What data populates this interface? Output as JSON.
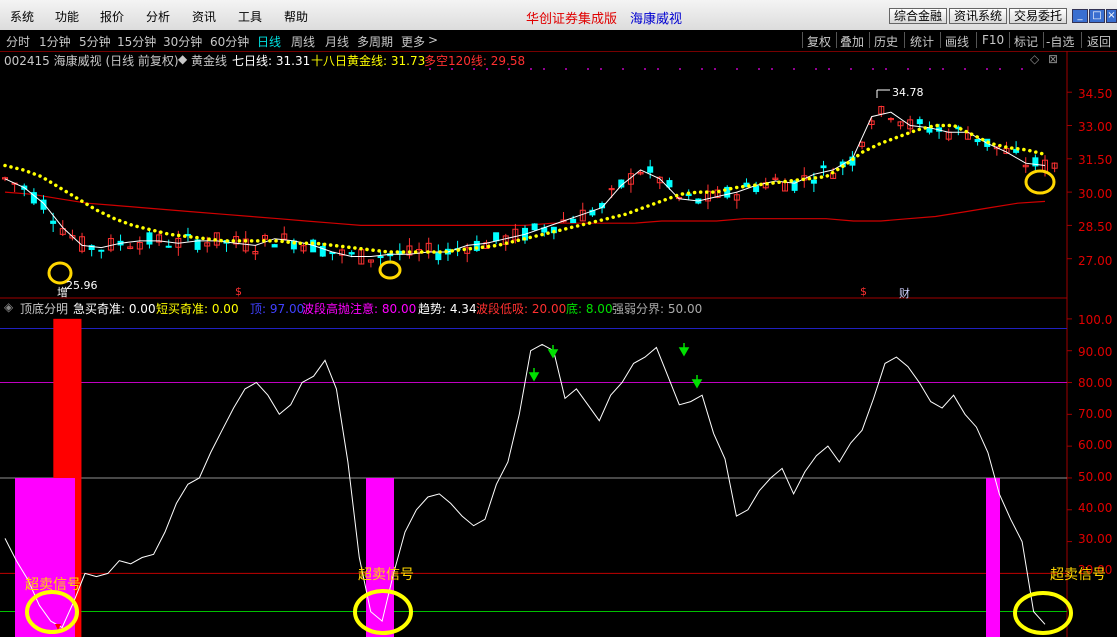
{
  "menu": {
    "items": [
      "系统",
      "功能",
      "报价",
      "分析",
      "资讯",
      "工具",
      "帮助"
    ],
    "app_title": "华创证券集成版",
    "stock_title": "海康威视",
    "buttons": [
      "综合金融",
      "资讯系统",
      "交易委托"
    ]
  },
  "periods": {
    "items": [
      "分时",
      "1分钟",
      "5分钟",
      "15分钟",
      "30分钟",
      "60分钟",
      "日线",
      "周线",
      "月线",
      "多周期",
      "更多"
    ],
    "active": "日线",
    "tools": [
      "复权",
      "叠加",
      "历史",
      "统计",
      "画线",
      "F10",
      "标记",
      "-自选",
      "返回"
    ]
  },
  "main_info": {
    "code_name": "002415 海康威视 (日线 前复权)",
    "indicator": "黄金线",
    "ma7_label": "七日线: 31.31",
    "ma18_label": "十八日黄金线: 31.73",
    "ma120_label": "多空120线: 29.58"
  },
  "main_axis": {
    "labels": [
      "34.50",
      "33.00",
      "31.50",
      "30.00",
      "28.50",
      "27.00"
    ]
  },
  "annotations": {
    "high_price": "34.78",
    "low_price": "25.96",
    "low_prefix": "增",
    "marker_s": "$",
    "marker_cai": "财"
  },
  "indicator_info": {
    "name": "顶底分明",
    "fields": [
      {
        "text": "急买奇准: 0.00",
        "color": "#ffffff"
      },
      {
        "text": "短买奇准: 0.00",
        "color": "#ffff00"
      },
      {
        "text": "顶: 97.00",
        "color": "#4040ff"
      },
      {
        "text": "波段高抛注意: 80.00",
        "color": "#ff00ff"
      },
      {
        "text": "趋势: 4.34",
        "color": "#ffffff"
      },
      {
        "text": "波段低吸: 20.00",
        "color": "#ff3030"
      },
      {
        "text": "底: 8.00",
        "color": "#00e000"
      },
      {
        "text": "强弱分界: 50.00",
        "color": "#aaaaaa"
      }
    ]
  },
  "indicator_axis": {
    "labels": [
      "100.0",
      "90.00",
      "80.00",
      "70.00",
      "60.00",
      "50.00",
      "40.00",
      "30.00",
      "20.00"
    ]
  },
  "signals": {
    "oversold": "超卖信号"
  },
  "chart_data": [
    {
      "type": "candlestick",
      "title": "002415 海康威视 (日线 前复权)",
      "ylim": [
        25.5,
        35.5
      ],
      "series": [
        {
          "name": "黄金线",
          "color": "#ffff00",
          "values": [
            31.2,
            31.0,
            30.7,
            30.2,
            29.7,
            29.2,
            28.8,
            28.5,
            28.3,
            28.1,
            28.0,
            27.9,
            27.8,
            27.8,
            27.8,
            27.8,
            27.7,
            27.7,
            27.6,
            27.5,
            27.4,
            27.3,
            27.3,
            27.3,
            27.3,
            27.4,
            27.5,
            27.6,
            27.8,
            28.0,
            28.2,
            28.4,
            28.6,
            28.8,
            29.0,
            29.3,
            29.6,
            29.9,
            30.0,
            30.0,
            30.2,
            30.3,
            30.4,
            30.5,
            30.6,
            30.7,
            31.2,
            31.8,
            32.2,
            32.5,
            32.8,
            33.0,
            33.0,
            32.6,
            32.2,
            32.0,
            31.9,
            31.7
          ]
        },
        {
          "name": "七日线",
          "color": "#ffffff",
          "values": [
            30.6,
            30.2,
            29.5,
            28.4,
            27.6,
            27.5,
            27.7,
            27.8,
            27.8,
            27.7,
            27.8,
            27.8,
            27.7,
            27.6,
            27.9,
            27.8,
            27.6,
            27.3,
            27.1,
            27.1,
            27.2,
            27.2,
            27.3,
            27.3,
            27.6,
            27.7,
            27.9,
            28.1,
            28.4,
            28.7,
            29.0,
            29.3,
            30.3,
            31.0,
            30.6,
            29.7,
            29.6,
            29.8,
            30.0,
            30.3,
            30.5,
            30.4,
            30.8,
            31.0,
            31.5,
            33.4,
            33.6,
            33.0,
            32.9,
            32.7,
            32.7,
            32.2,
            31.8,
            31.3,
            31.2
          ]
        },
        {
          "name": "多空120线",
          "color": "#d00000",
          "values": [
            30.0,
            29.9,
            29.7,
            29.5,
            29.4,
            29.3,
            29.2,
            29.1,
            29.0,
            28.9,
            28.8,
            28.7,
            28.6,
            28.5,
            28.5,
            28.5,
            28.5,
            28.5,
            28.5,
            28.5,
            28.6,
            28.6,
            28.6,
            28.6,
            28.7,
            28.7,
            28.7,
            28.8,
            28.8,
            28.8,
            28.8,
            28.7,
            28.7,
            28.8,
            28.9,
            29.1,
            29.3,
            29.5,
            29.58
          ]
        }
      ],
      "annotations": [
        {
          "text": "34.78",
          "value": 34.78
        },
        {
          "text": "25.96",
          "value": 25.96
        }
      ]
    },
    {
      "type": "line",
      "title": "顶底分明",
      "ylim": [
        0,
        105
      ],
      "reference_lines": [
        {
          "name": "顶",
          "value": 97,
          "color": "#2020c0"
        },
        {
          "name": "波段高抛注意",
          "value": 80,
          "color": "#c000c0"
        },
        {
          "name": "强弱分界",
          "value": 50,
          "color": "#909090"
        },
        {
          "name": "波段低吸",
          "value": 20,
          "color": "#c00000"
        },
        {
          "name": "底",
          "value": 8,
          "color": "#00c000"
        }
      ],
      "series": [
        {
          "name": "趋势",
          "color": "#ffffff",
          "values": [
            31,
            24,
            18,
            10,
            5,
            3,
            11,
            20,
            19,
            20,
            24,
            23,
            25,
            26,
            33,
            42,
            48,
            50,
            58,
            65,
            72,
            78,
            80,
            76,
            70,
            73,
            80,
            82,
            87,
            78,
            55,
            25,
            8,
            5,
            20,
            33,
            40,
            44,
            45,
            42,
            38,
            35,
            37,
            48,
            55,
            70,
            90,
            92,
            90,
            75,
            78,
            73,
            68,
            76,
            80,
            86,
            88,
            91,
            82,
            73,
            74,
            76,
            64,
            56,
            38,
            40,
            46,
            50,
            53,
            45,
            52,
            57,
            60,
            55,
            61,
            65,
            75,
            86,
            88,
            85,
            80,
            74,
            72,
            76,
            70,
            66,
            58,
            45,
            37,
            30,
            8,
            4
          ]
        },
        {
          "name": "急买奇准",
          "color": "#ff0000",
          "bars": [
            {
              "position": 0.06,
              "value": 100
            }
          ]
        },
        {
          "name": "短买奇准",
          "color": "#ff00ff",
          "bars": [
            {
              "position": 0.04,
              "value": 50
            },
            {
              "position": 0.35,
              "value": 50
            },
            {
              "position": 0.89,
              "value": 50
            }
          ]
        }
      ]
    }
  ]
}
